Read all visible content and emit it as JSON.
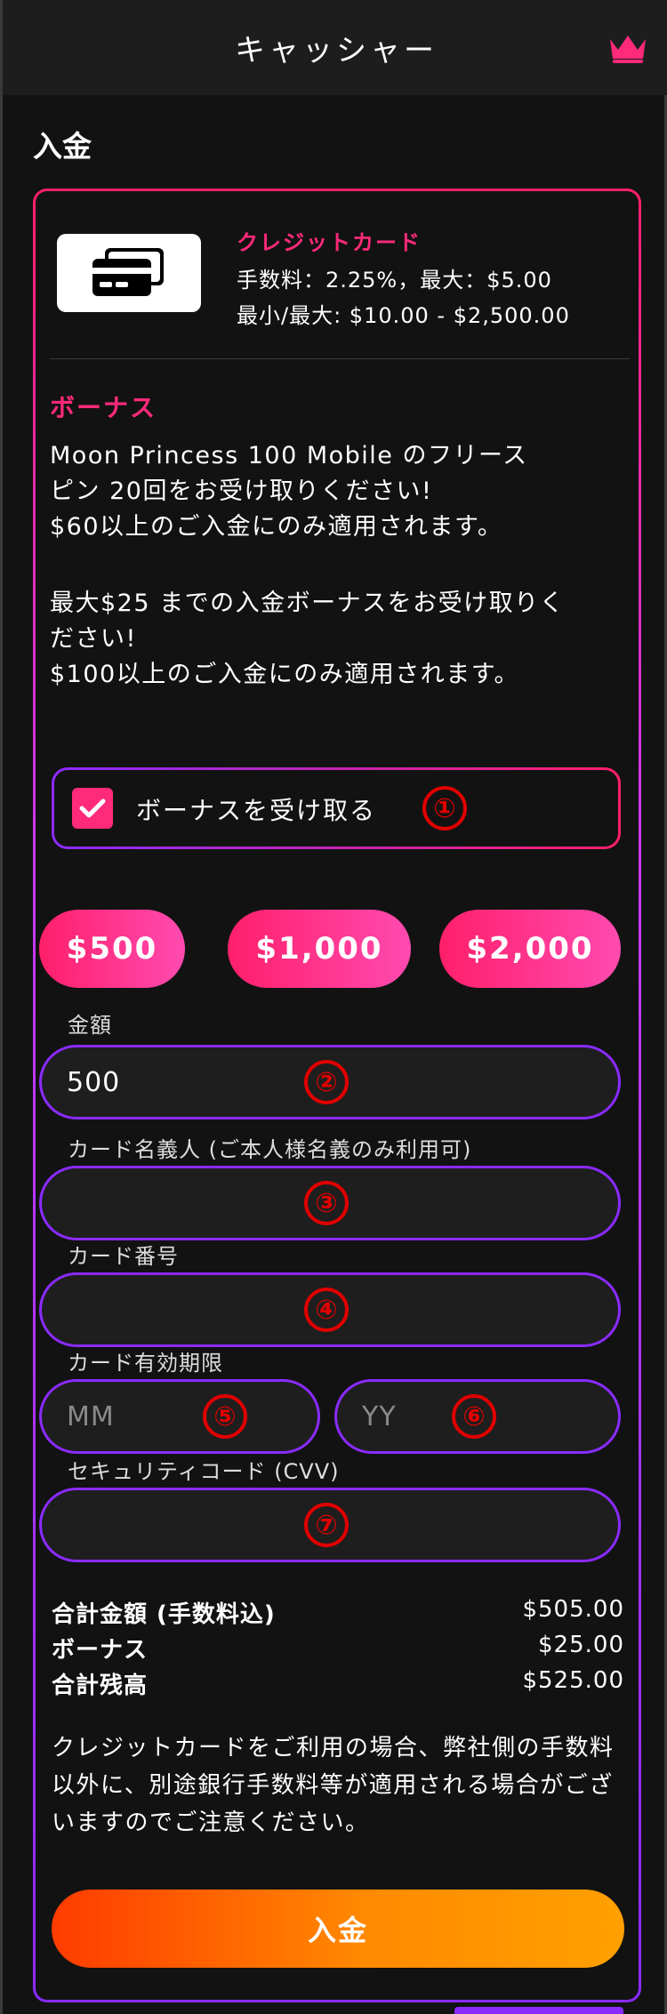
{
  "header": {
    "title": "キャッシャー",
    "icon": "crown-icon",
    "icon_color": "#ff2a7a"
  },
  "section": {
    "title": "入金"
  },
  "payment_method": {
    "icon": "credit-card-icon",
    "name": "クレジットカード",
    "fee": "手数料：2.25%，最大：$5.00",
    "limits": "最小/最大: $10.00 - $2,500.00"
  },
  "bonus": {
    "title": "ボーナス",
    "line1": "Moon Princess 100 Mobile のフリース",
    "line2": "ピン 20回をお受け取りください!",
    "line3": "$60以上のご入金にのみ適用されます。",
    "line4": "最大$25 までの入金ボーナスをお受け取りく",
    "line5": "ださい!",
    "line6": "$100以上のご入金にのみ適用されます。",
    "checkbox_label": "ボーナスを受け取る",
    "checked": true
  },
  "markers": [
    "①",
    "②",
    "③",
    "④",
    "⑤",
    "⑥",
    "⑦"
  ],
  "quick_amounts": [
    "$500",
    "$1,000",
    "$2,000"
  ],
  "form": {
    "amount_label": "金額",
    "amount_value": "500",
    "holder_label": "カード名義人 (ご本人様名義のみ利用可)",
    "holder_value": "",
    "number_label": "カード番号",
    "number_value": "",
    "expiry_label": "カード有効期限",
    "month_placeholder": "MM",
    "year_placeholder": "YY",
    "cvv_label": "セキュリティコード (CVV)",
    "cvv_value": ""
  },
  "summary": [
    {
      "label": "合計金額 (手数料込)",
      "value": "$505.00"
    },
    {
      "label": "ボーナス",
      "value": "$25.00"
    },
    {
      "label": "合計残高",
      "value": "$525.00"
    }
  ],
  "notice": "クレジットカードをご利用の場合、弊社側の手数料以外に、別途銀行手数料等が適用される場合がございますのでご注意ください。",
  "deposit_button": "入金",
  "colors": {
    "accent": "#ff2a7a",
    "border": "#8a2bff",
    "deposit_start": "#ff3b00",
    "deposit_end": "#ffa000",
    "marker": "#e00000"
  }
}
